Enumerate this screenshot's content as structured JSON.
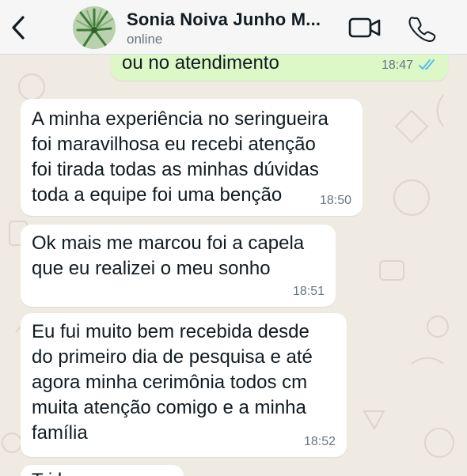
{
  "header": {
    "contact_name": "Sonia Noiva Junho  M...",
    "status": "online"
  },
  "messages": [
    {
      "direction": "outgoing",
      "text": "ou no atendimento",
      "time": "18:47",
      "read": true
    },
    {
      "direction": "incoming",
      "text": "A minha experiência no seringueira\nfoi maravilhosa eu recebi atenção\nfoi tirada todas as minhas dúvidas\ntoda a equipe foi uma benção",
      "time": "18:50"
    },
    {
      "direction": "incoming",
      "text": "Ok mais me marcou foi a capela\nque eu realizei o meu sonho",
      "time": "18:51"
    },
    {
      "direction": "incoming",
      "text": "Eu fui muito bem recebida desde\ndo primeiro dia de pesquisa e até\nagora minha cerimônia todos cm\nmuita atenção comigo e a minha\nfamília",
      "time": "18:52"
    },
    {
      "direction": "incoming",
      "text": "T   i   l",
      "time": ""
    }
  ],
  "icons": {
    "back": "chevron-left-icon",
    "video": "video-call-icon",
    "phone": "phone-call-icon",
    "read_receipt": "double-check-icon"
  },
  "colors": {
    "chat_background": "#efeae2",
    "incoming_bubble": "#ffffff",
    "outgoing_bubble": "#dcf8c6",
    "read_ticks": "#53bdeb",
    "icons": "#111b21"
  }
}
